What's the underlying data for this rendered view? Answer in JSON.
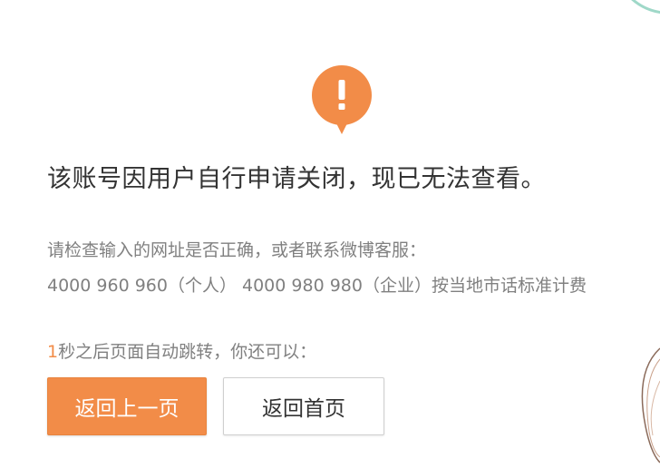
{
  "icon": {
    "name": "exclamation-icon",
    "color": "#f28c48",
    "glyph": "!"
  },
  "message": {
    "title": "该账号因用户自行申请关闭，现已无法查看。",
    "hint": "请检查输入的网址是否正确，或者联系微博客服：",
    "hotline": "4000 960 960（个人） 4000 980 980（企业）按当地市话标准计费"
  },
  "countdown": {
    "seconds": "1",
    "text": "秒之后页面自动跳转，你还可以："
  },
  "actions": {
    "back_label": "返回上一页",
    "home_label": "返回首页"
  },
  "colors": {
    "accent": "#f28c48",
    "text": "#333333",
    "muted": "#808080"
  }
}
